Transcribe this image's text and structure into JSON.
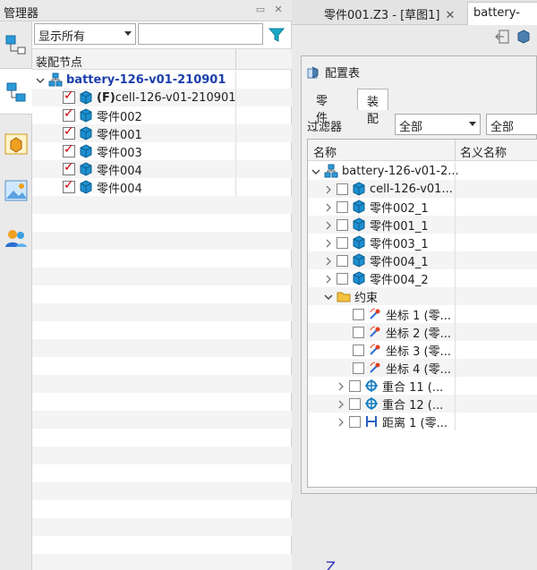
{
  "manager": {
    "title": "管理器",
    "filter_select": "显示所有",
    "filter_text": "",
    "column_header": "装配节点",
    "tree": [
      {
        "label": "battery-126-v01-210901",
        "kind": "root"
      },
      {
        "label_prefix": "(F)",
        "label": "cell-126-v01-210901",
        "kind": "part",
        "checked": true
      },
      {
        "label": "零件002",
        "kind": "part",
        "checked": true
      },
      {
        "label": "零件001",
        "kind": "part",
        "checked": true
      },
      {
        "label": "零件003",
        "kind": "part",
        "checked": true
      },
      {
        "label": "零件004",
        "kind": "part",
        "checked": true
      },
      {
        "label": "零件004",
        "kind": "part",
        "checked": true
      }
    ]
  },
  "doc_tabs": [
    {
      "label": "零件001.Z3 - [草图1]",
      "close": "✕"
    },
    {
      "label": "battery-"
    }
  ],
  "config": {
    "title": "配置表",
    "tabs": [
      "零件",
      "装配"
    ],
    "active_tab": "装配",
    "filter_label": "过滤器",
    "filter_value_1": "全部",
    "filter_value_2": "全部",
    "col_name": "名称",
    "col_nominal": "名义名称",
    "rows": [
      {
        "label": "battery-126-v01-2...",
        "kind": "root"
      },
      {
        "label": "cell-126-v01...",
        "kind": "part"
      },
      {
        "label": "零件002_1",
        "kind": "part"
      },
      {
        "label": "零件001_1",
        "kind": "part"
      },
      {
        "label": "零件003_1",
        "kind": "part"
      },
      {
        "label": "零件004_1",
        "kind": "part"
      },
      {
        "label": "零件004_2",
        "kind": "part"
      },
      {
        "label": "约束",
        "kind": "folder"
      },
      {
        "label": "坐标 1 (零...",
        "kind": "coord"
      },
      {
        "label": "坐标 2 (零...",
        "kind": "coord"
      },
      {
        "label": "坐标 3 (零...",
        "kind": "coord"
      },
      {
        "label": "坐标 4 (零...",
        "kind": "coord"
      },
      {
        "label": "重合 11 (...",
        "kind": "coincide"
      },
      {
        "label": "重合 12 (...",
        "kind": "coincide"
      },
      {
        "label": "距离 1 (零...",
        "kind": "distance"
      }
    ]
  },
  "viewport": {
    "axis_label": "Z"
  },
  "colors": {
    "accent": "#1b3faa",
    "check": "#d00000",
    "part_blue": "#1d8fd0"
  }
}
